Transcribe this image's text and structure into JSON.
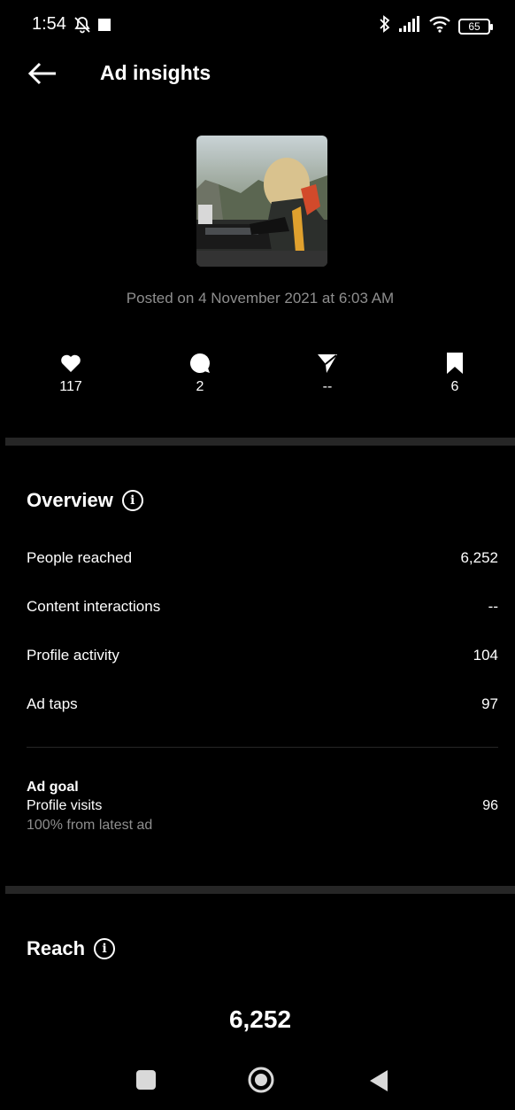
{
  "status_bar": {
    "time": "1:54",
    "battery": "65"
  },
  "header": {
    "title": "Ad insights"
  },
  "post": {
    "posted_text": "Posted on 4 November 2021 at 6:03 AM"
  },
  "stats": {
    "likes": "117",
    "comments": "2",
    "shares": "--",
    "saves": "6"
  },
  "overview": {
    "title": "Overview",
    "rows": [
      {
        "label": "People reached",
        "value": "6,252"
      },
      {
        "label": "Content interactions",
        "value": "--"
      },
      {
        "label": "Profile activity",
        "value": "104"
      },
      {
        "label": "Ad taps",
        "value": "97"
      }
    ],
    "ad_goal": {
      "title": "Ad goal",
      "label": "Profile visits",
      "value": "96",
      "note": "100% from latest ad"
    }
  },
  "reach": {
    "title": "Reach",
    "value": "6,252"
  }
}
